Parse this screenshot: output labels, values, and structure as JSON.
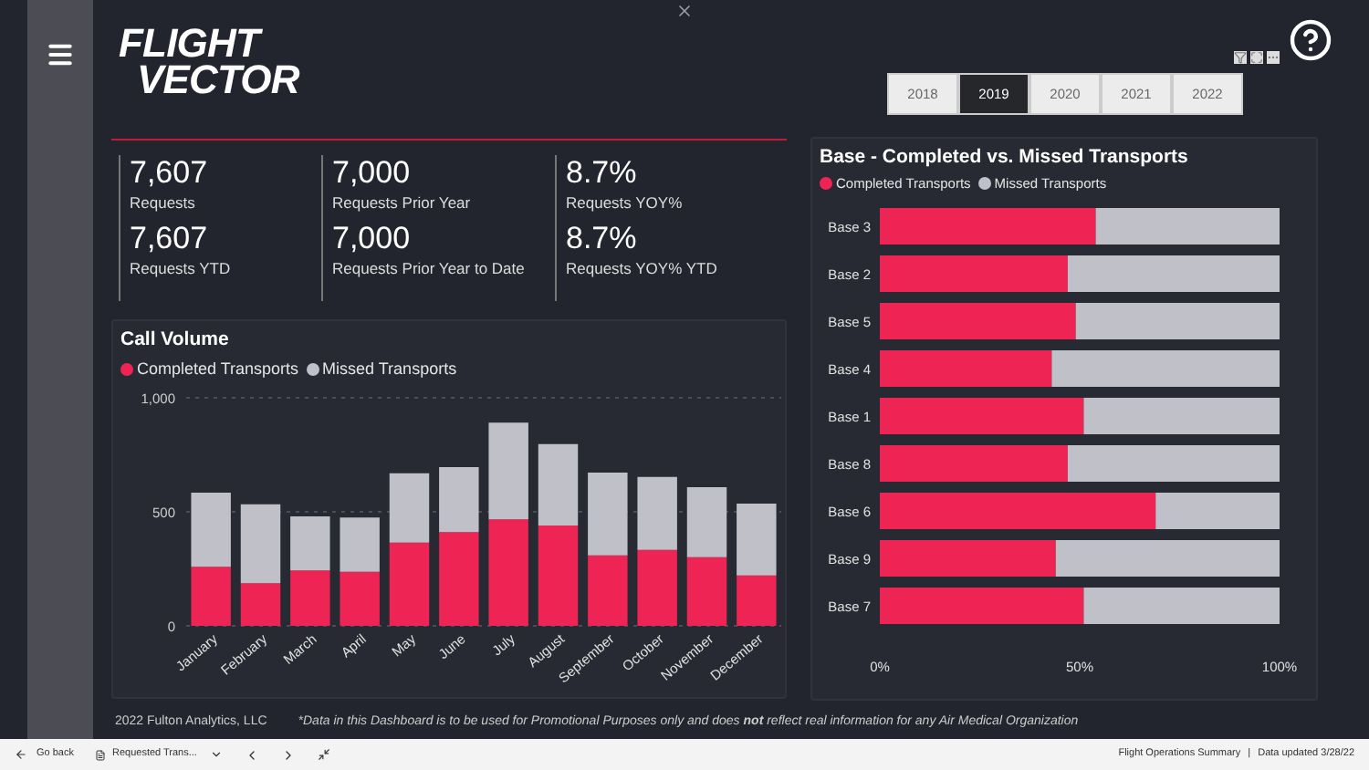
{
  "logo": {
    "line1": "FLIGHT",
    "line2": "VECTOR"
  },
  "kpis": [
    {
      "value": "7,607",
      "label": "Requests",
      "ytd_value": "7,607",
      "ytd_label": "Requests YTD"
    },
    {
      "value": "7,000",
      "label": "Requests Prior Year",
      "ytd_value": "7,000",
      "ytd_label": "Requests Prior Year to Date"
    },
    {
      "value": "8.7%",
      "label": "Requests YOY%",
      "ytd_value": "8.7%",
      "ytd_label": "Requests YOY% YTD"
    }
  ],
  "years": [
    {
      "label": "2018",
      "selected": false
    },
    {
      "label": "2019",
      "selected": true
    },
    {
      "label": "2020",
      "selected": false
    },
    {
      "label": "2021",
      "selected": false
    },
    {
      "label": "2022",
      "selected": false
    }
  ],
  "call_volume": {
    "chart_data": {
      "type": "bar",
      "title": "Call Volume",
      "stacked": true,
      "categories": [
        "January",
        "February",
        "March",
        "April",
        "May",
        "June",
        "July",
        "August",
        "September",
        "October",
        "November",
        "December"
      ],
      "series": [
        {
          "name": "Completed Transports",
          "color": "#ee2455",
          "values": [
            259,
            187,
            243,
            237,
            365,
            411,
            467,
            440,
            309,
            333,
            301,
            221
          ]
        },
        {
          "name": "Missed Transports",
          "color": "#bfc0c8",
          "values": [
            325,
            346,
            237,
            238,
            304,
            285,
            424,
            357,
            363,
            320,
            307,
            315
          ]
        }
      ],
      "ylim": [
        0,
        1000
      ],
      "yticks": [
        0,
        500,
        {
          "value": 1000,
          "label": "1,000"
        }
      ]
    }
  },
  "base_chart": {
    "chart_data": {
      "type": "bar",
      "title": "Base - Completed vs. Missed Transports",
      "stacked": true,
      "orientation": "horizontal",
      "categories": [
        "Base 3",
        "Base 2",
        "Base 5",
        "Base 4",
        "Base 1",
        "Base 8",
        "Base 6",
        "Base 9",
        "Base 7"
      ],
      "series": [
        {
          "name": "Completed Transports",
          "color": "#ee2455",
          "values": [
            54,
            47,
            49,
            43,
            51,
            47,
            69,
            44,
            51
          ]
        },
        {
          "name": "Missed Transports",
          "color": "#bfc0c8",
          "values": [
            46,
            53,
            51,
            57,
            49,
            53,
            31,
            56,
            49
          ]
        }
      ],
      "xlim": [
        0,
        100
      ],
      "xticks": [
        {
          "value": 0,
          "label": "0%"
        },
        {
          "value": 50,
          "label": "50%"
        },
        {
          "value": 100,
          "label": "100%"
        }
      ]
    }
  },
  "footer": {
    "copyright": "2022 Fulton Analytics, LLC",
    "disclaimer": "*Data in this Dashboard is to be used for Promotional Purposes only and does **not** reflect real information for any Air Medical Organization"
  },
  "status_bar": {
    "back": "Go back",
    "page": "Requested Trans...",
    "report": "Flight Operations Summary",
    "separator": "|",
    "updated": "Data updated 3/28/22"
  }
}
